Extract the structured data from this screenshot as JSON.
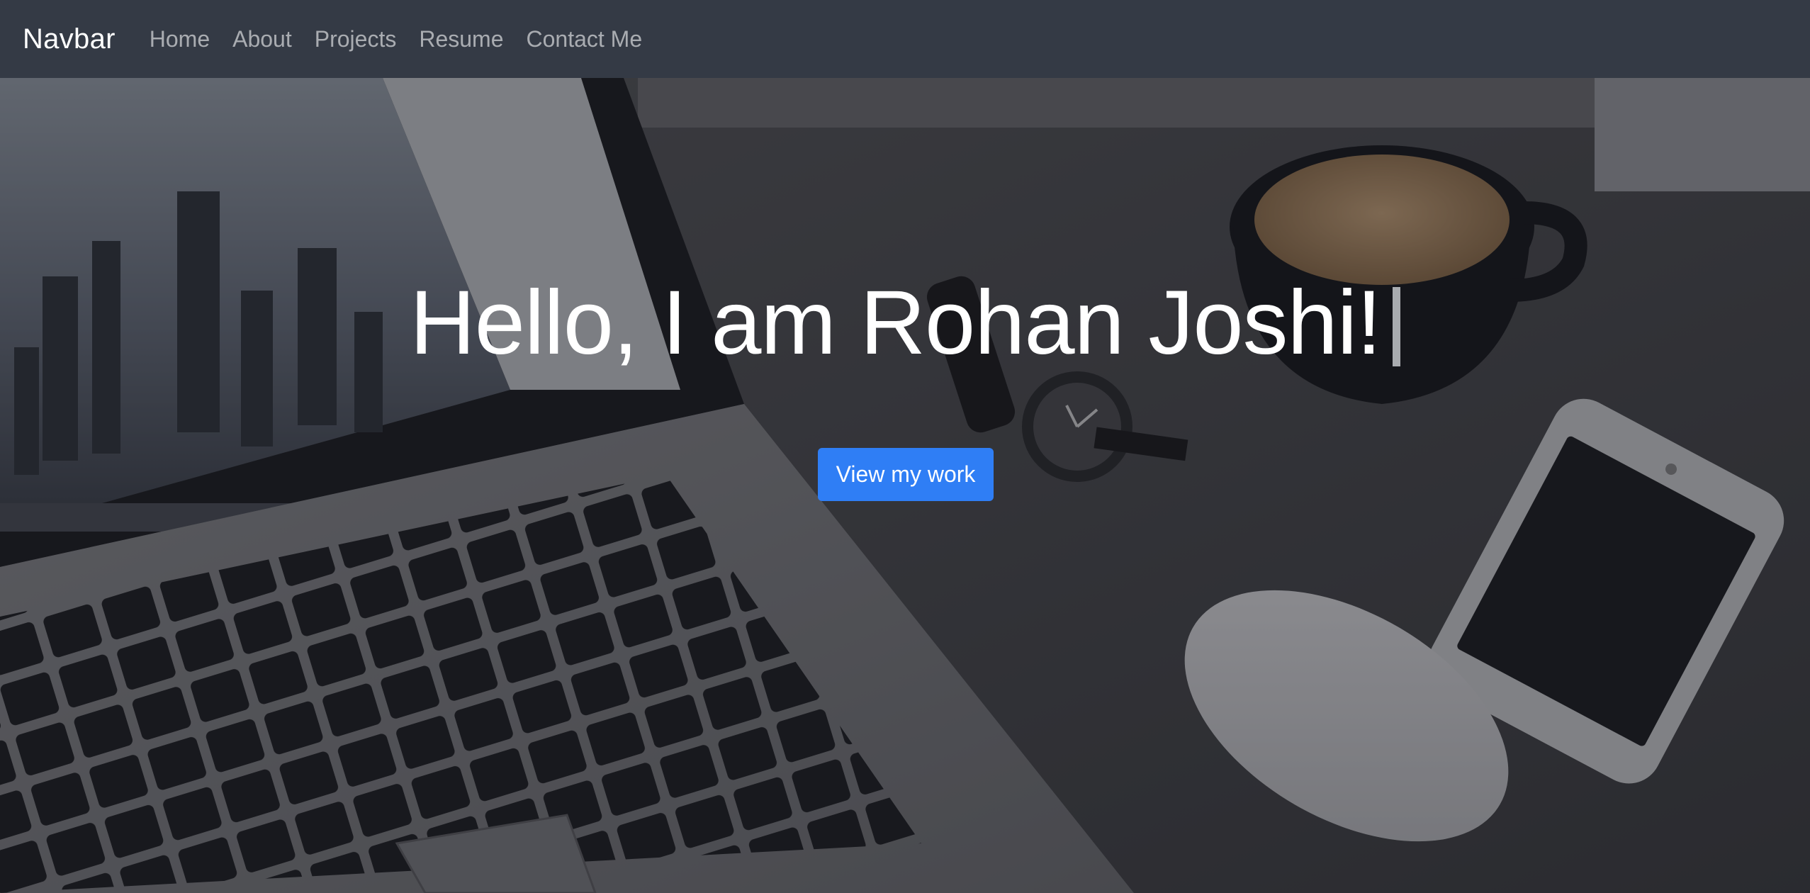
{
  "navbar": {
    "brand": "Navbar",
    "links": [
      {
        "label": "Home"
      },
      {
        "label": "About"
      },
      {
        "label": "Projects"
      },
      {
        "label": "Resume"
      },
      {
        "label": "Contact Me"
      }
    ],
    "background_color": "#343a45"
  },
  "hero": {
    "headline": "Hello, I am Rohan Joshi!",
    "cta_label": "View my work",
    "cta_color": "#2f7ef5",
    "background_image": "desk workspace photo with laptop, coffee cup, watch, phone and mouse (darkened)"
  }
}
